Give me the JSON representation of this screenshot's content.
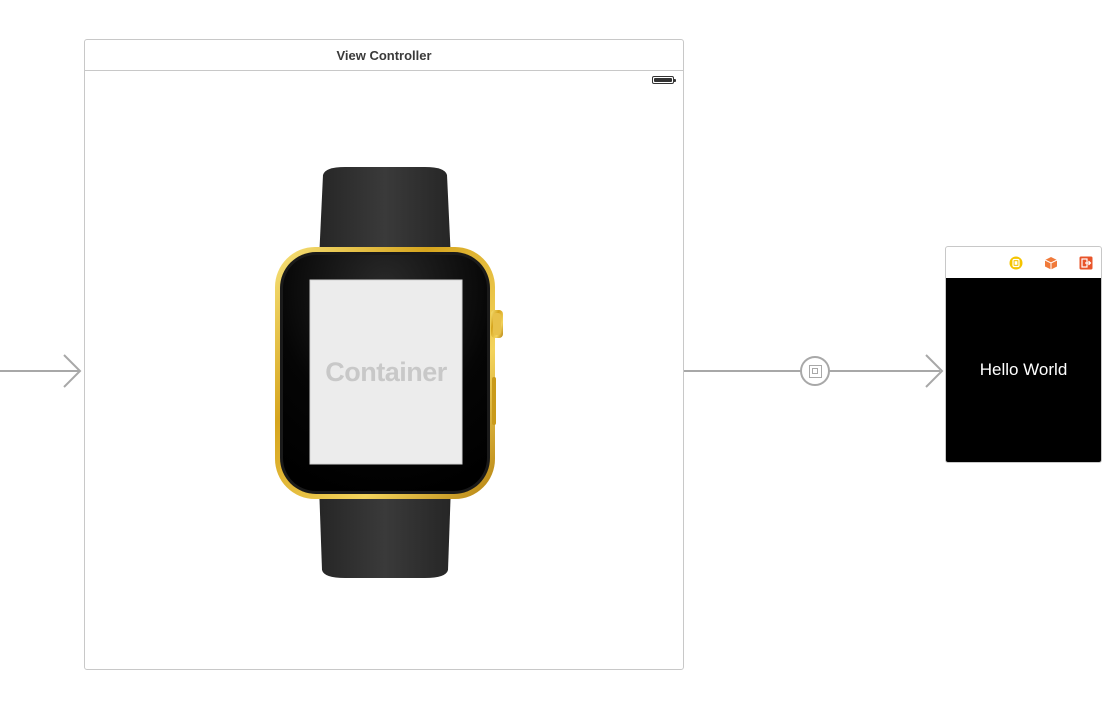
{
  "storyboard": {
    "view_controller": {
      "title": "View Controller",
      "container_label": "Container"
    },
    "interface_controller": {
      "label_text": "Hello World",
      "dock_icons": [
        "interface-controller-icon",
        "first-responder-icon",
        "exit-icon"
      ]
    },
    "colors": {
      "scene_border": "#c8c8c8",
      "connector": "#a8a8a8",
      "watch_gold": "#d4a017",
      "watch_band": "#2a2a2a",
      "container_fill": "#ececec",
      "ic_background": "#000000",
      "controller_icon": "#f5c400",
      "responder_icon": "#f07a3a",
      "exit_icon": "#e8542a"
    }
  }
}
